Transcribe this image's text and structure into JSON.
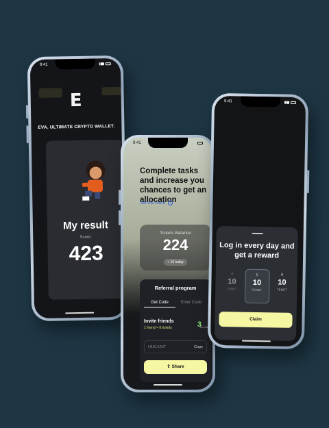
{
  "phone1": {
    "time": "9:41",
    "logo": "E",
    "brand": "EVA. ULTIMATE CRYPTO WALLET.",
    "result_title": "My result",
    "score_label": "Score:",
    "score": "423"
  },
  "phone2": {
    "time": "9:41",
    "title": "Complete tasks and increase you chances to get an allocation",
    "tell_more": "Tell me more",
    "tickets_label": "Tickets Balance",
    "tickets_value": "224",
    "tickets_today": "+ 16 today",
    "referral_title": "Referral program",
    "tab_get_code": "Get Code",
    "tab_enter_code": "Enter Code",
    "invite_title": "Invite friends",
    "invite_sub": "1 friend = 8 tickets",
    "friends_count": "3",
    "friends_label": "friends",
    "code": "H1014JUT",
    "copy": "Copy",
    "share": "Share"
  },
  "phone3": {
    "time": "9:41",
    "title": "Log in every day and get a reward",
    "days": [
      {
        "num": "4",
        "value": "10",
        "unit": "TENET"
      },
      {
        "num": "5",
        "value": "10",
        "unit": "TENET"
      },
      {
        "num": "6",
        "value": "10",
        "unit": "TENET"
      }
    ],
    "claim": "Claim"
  },
  "colors": {
    "background": "#1e3644",
    "accent_yellow": "#f6f7a2",
    "link_blue": "#2b55d6",
    "green": "#8fe27a"
  }
}
